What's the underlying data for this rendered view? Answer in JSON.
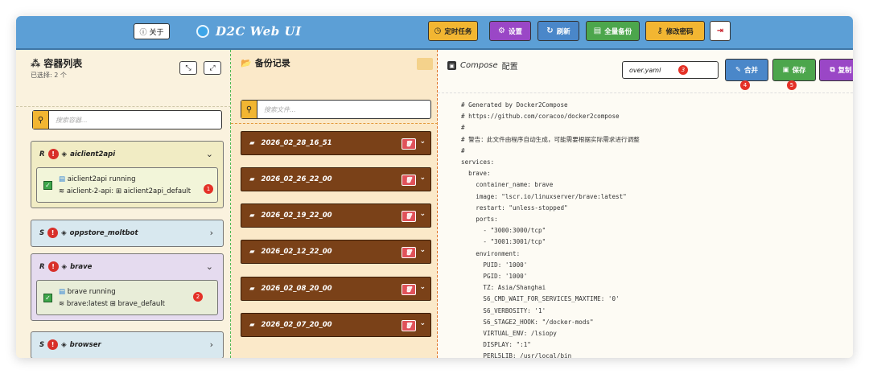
{
  "header": {
    "about_label": "关于",
    "about_icon": "info-circle-icon",
    "app_title": "D2C Web UI",
    "buttons": [
      {
        "label": "定时任务",
        "icon": "clock-icon",
        "color": "#f2b632",
        "text_color": "#222222"
      },
      {
        "label": "设置",
        "icon": "gear-icon",
        "color": "#9a47c6",
        "text_color": "#ffffff"
      },
      {
        "label": "刷新",
        "icon": "refresh-icon",
        "color": "#4a87c9",
        "text_color": "#ffffff"
      },
      {
        "label": "全量备份",
        "icon": "file-icon",
        "color": "#4ca64c",
        "text_color": "#ffffff"
      },
      {
        "label": "修改密码",
        "icon": "key-icon",
        "color": "#f2b632",
        "text_color": "#222222"
      }
    ],
    "logout_icon": "logout-icon"
  },
  "containers_panel": {
    "title": "容器列表",
    "selected_text": "已选择: 2 个",
    "search_placeholder": "搜索容器...",
    "items": [
      {
        "mode": "R",
        "name": "aiclient2api",
        "expanded": true,
        "bg": "#f1ecc4",
        "status": "aiclient2api running",
        "detail": "aiclient-2-api:",
        "network": "aiclient2api_default",
        "marker": "1"
      },
      {
        "mode": "S",
        "name": "oppstore_moltbot",
        "expanded": false,
        "bg": "#d8e8ef"
      },
      {
        "mode": "R",
        "name": "brave",
        "expanded": true,
        "bg": "#e5dbef",
        "status": "brave running",
        "detail": "brave:latest",
        "network": "brave_default",
        "marker": "2"
      },
      {
        "mode": "S",
        "name": "browser",
        "expanded": false,
        "bg": "#d8e8ef"
      }
    ]
  },
  "backups_panel": {
    "title": "备份记录",
    "search_placeholder": "搜索文件...",
    "items": [
      "2026_02_28_16_51",
      "2026_02_26_22_00",
      "2026_02_19_22_00",
      "2026_02_12_22_00",
      "2026_02_08_20_00",
      "2026_02_07_20_00"
    ]
  },
  "compose_panel": {
    "title_en": "Compose",
    "title_cn": "配置",
    "filename": "over.yaml",
    "filename_marker": "3",
    "merge_label": "合并",
    "merge_marker": "4",
    "save_label": "保存",
    "save_marker": "5",
    "copy_label": "复制",
    "code_lines": [
      "# Generated by Docker2Compose",
      "# https://github.com/coracoo/docker2compose",
      "#",
      "# 警告：此文件由程序自动生成，可能需要根据实际需求进行调整",
      "#",
      "services:",
      "  brave:",
      "    container_name: brave",
      "    image: \"lscr.io/linuxserver/brave:latest\"",
      "    restart: \"unless-stopped\"",
      "    ports:",
      "      - \"3000:3000/tcp\"",
      "      - \"3001:3001/tcp\"",
      "    environment:",
      "      PUID: '1000'",
      "      PGID: '1000'",
      "      TZ: Asia/Shanghai",
      "      S6_CMD_WAIT_FOR_SERVICES_MAXTIME: '0'",
      "      S6_VERBOSITY: '1'",
      "      S6_STAGE2_HOOK: \"/docker-mods\"",
      "      VIRTUAL_ENV: /lsiopy",
      "      DISPLAY: \":1\"",
      "      PERL5LIB: /usr/local/bin"
    ]
  }
}
